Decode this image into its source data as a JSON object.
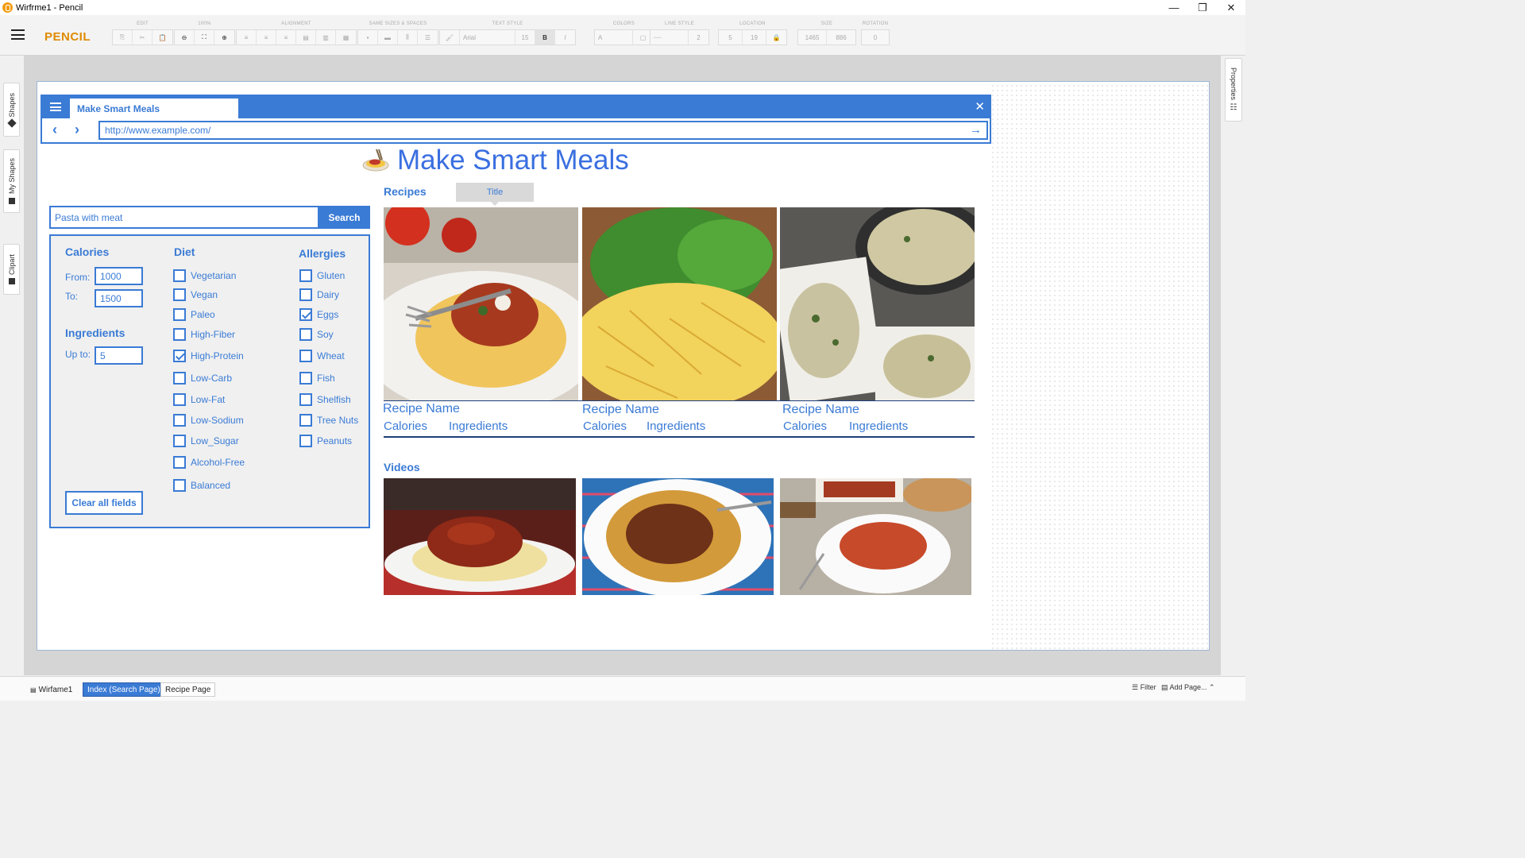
{
  "app": {
    "window_title": "Wirfrme1 - Pencil",
    "brand": "PENCIL"
  },
  "toolbar": {
    "groups": {
      "edit": "EDIT",
      "zoom": "100%",
      "alignment": "ALIGNMENT",
      "same_sizes": "SAME SIZES & SPACES",
      "text_style": "TEXT STYLE",
      "colors": "COLORS",
      "line_style": "LINE STYLE",
      "location": "LOCATION",
      "size": "SIZE",
      "rotation": "ROTATION"
    },
    "font_name": "Arial",
    "font_size": "15",
    "bold": "B",
    "italic": "I",
    "text_color": "A",
    "line_width": "2",
    "loc_x": "5",
    "loc_y": "19",
    "size_w": "1465",
    "size_h": "886",
    "rotation": "0"
  },
  "side_tabs": {
    "shapes": "Shapes",
    "my_shapes": "My Shapes",
    "clipart": "Clipart",
    "properties": "Properties"
  },
  "browser": {
    "tab_title": "Make Smart Meals",
    "url": "http://www.example.com/"
  },
  "header": {
    "title": "Make Smart Meals"
  },
  "search": {
    "value": "Pasta with meat",
    "button": "Search"
  },
  "filters": {
    "calories": {
      "heading": "Calories",
      "from_label": "From:",
      "from_value": "1000",
      "to_label": "To:",
      "to_value": "1500"
    },
    "ingredients": {
      "heading": "Ingredients",
      "upto_label": "Up to:",
      "upto_value": "5"
    },
    "diet": {
      "heading": "Diet",
      "items": [
        {
          "label": "Vegetarian",
          "checked": false
        },
        {
          "label": "Vegan",
          "checked": false
        },
        {
          "label": "Paleo",
          "checked": false
        },
        {
          "label": "High-Fiber",
          "checked": false
        },
        {
          "label": "High-Protein",
          "checked": true
        },
        {
          "label": "Low-Carb",
          "checked": false
        },
        {
          "label": "Low-Fat",
          "checked": false
        },
        {
          "label": "Low-Sodium",
          "checked": false
        },
        {
          "label": "Low_Sugar",
          "checked": false
        },
        {
          "label": "Alcohol-Free",
          "checked": false
        },
        {
          "label": "Balanced",
          "checked": false
        }
      ]
    },
    "allergies": {
      "heading": "Allergies",
      "items": [
        {
          "label": "Gluten",
          "checked": false
        },
        {
          "label": "Dairy",
          "checked": false
        },
        {
          "label": "Eggs",
          "checked": true
        },
        {
          "label": "Soy",
          "checked": false
        },
        {
          "label": "Wheat",
          "checked": false
        },
        {
          "label": "Fish",
          "checked": false
        },
        {
          "label": "Shelfish",
          "checked": false
        },
        {
          "label": "Tree Nuts",
          "checked": false
        },
        {
          "label": "Peanuts",
          "checked": false
        }
      ]
    },
    "clear_button": "Clear all fields"
  },
  "recipes": {
    "heading": "Recipes",
    "tooltip": "Title",
    "cards": [
      {
        "name": "Recipe Name",
        "calories": "Calories",
        "ingredients": "Ingredients"
      },
      {
        "name": "Recipe Name",
        "calories": "Calories",
        "ingredients": "Ingredients"
      },
      {
        "name": "Recipe Name",
        "calories": "Calories",
        "ingredients": "Ingredients"
      }
    ]
  },
  "videos": {
    "heading": "Videos"
  },
  "bottom": {
    "doc_name": "Wirfame1",
    "pages": [
      "Index (Search Page)",
      "Recipe Page"
    ],
    "filter": "Filter",
    "add_page": "Add Page..."
  },
  "colors": {
    "accent": "#3a7bd5",
    "brand": "#e08a00",
    "title": "#3a6fe0"
  }
}
